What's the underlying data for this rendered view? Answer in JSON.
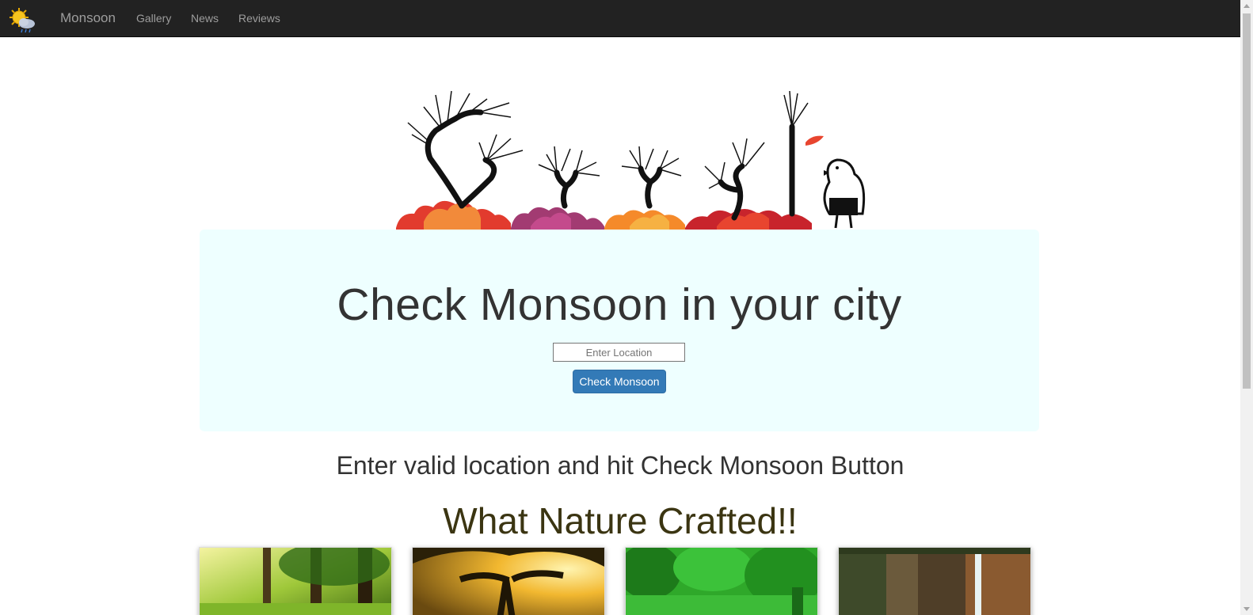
{
  "navbar": {
    "brand": "Monsoon",
    "links": [
      {
        "label": "Gallery"
      },
      {
        "label": "News"
      },
      {
        "label": "Reviews"
      }
    ],
    "logo_icon": "sun-cloud-rain-icon"
  },
  "hero": {
    "title": "Check Monsoon in your city",
    "input_placeholder": "Enter Location",
    "input_value": "",
    "button_label": "Check Monsoon"
  },
  "instruction": "Enter valid location and hit Check Monsoon Button",
  "gallery": {
    "title": "What Nature Crafted!!",
    "images": [
      {
        "subject": "sunlit-forest"
      },
      {
        "subject": "tree-at-sunset"
      },
      {
        "subject": "green-forest"
      },
      {
        "subject": "waterfall-cliff"
      }
    ]
  },
  "colors": {
    "navbar_bg": "#222222",
    "hero_bg": "#eeffff",
    "button_bg": "#337ab7",
    "gallery_title": "#3b3512"
  }
}
